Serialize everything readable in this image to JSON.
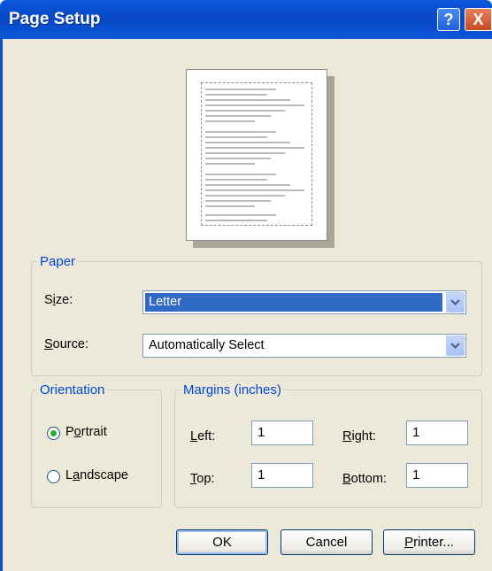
{
  "window": {
    "title": "Page Setup"
  },
  "titlebar_buttons": {
    "help": "?",
    "close": "X"
  },
  "paper": {
    "legend": "Paper",
    "size_label": "Size:",
    "size_value": "Letter",
    "source_label": "Source:",
    "source_value": "Automatically Select"
  },
  "orientation": {
    "legend": "Orientation",
    "portrait_label": "Portrait",
    "landscape_label": "Landscape",
    "selected": "portrait"
  },
  "margins": {
    "legend": "Margins (inches)",
    "left_label": "Left:",
    "left_value": "1",
    "right_label": "Right:",
    "right_value": "1",
    "top_label": "Top:",
    "top_value": "1",
    "bottom_label": "Bottom:",
    "bottom_value": "1"
  },
  "buttons": {
    "ok": "OK",
    "cancel": "Cancel",
    "printer": "Printer..."
  },
  "colors": {
    "titlebar": "#0848c4",
    "dialog_bg": "#ece9d8",
    "legend_text": "#0046d5",
    "selection": "#316ac5"
  }
}
